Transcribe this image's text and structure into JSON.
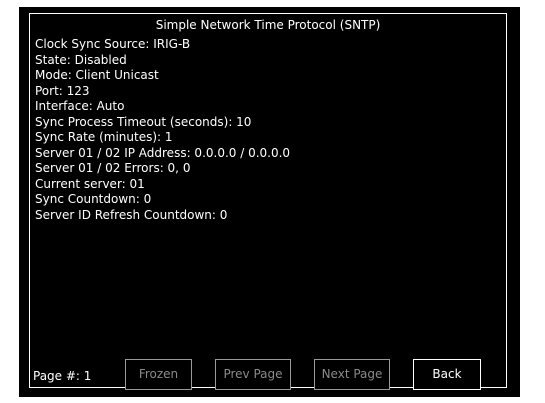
{
  "header": {
    "title": "Simple Network Time Protocol (SNTP)"
  },
  "fields": [
    "Clock Sync Source: IRIG-B",
    "State: Disabled",
    "Mode: Client Unicast",
    "Port: 123",
    "Interface: Auto",
    "Sync Process Timeout (seconds): 10",
    "Sync Rate (minutes): 1",
    "Server 01 / 02 IP Address: 0.0.0.0 / 0.0.0.0",
    "Server 01 / 02 Errors: 0, 0",
    "Current server: 01",
    "Sync Countdown: 0",
    "Server ID Refresh Countdown: 0"
  ],
  "footer": {
    "page_label": "Page #: 1",
    "buttons": {
      "frozen": "Frozen",
      "prev": "Prev Page",
      "next": "Next Page",
      "back": "Back"
    }
  }
}
